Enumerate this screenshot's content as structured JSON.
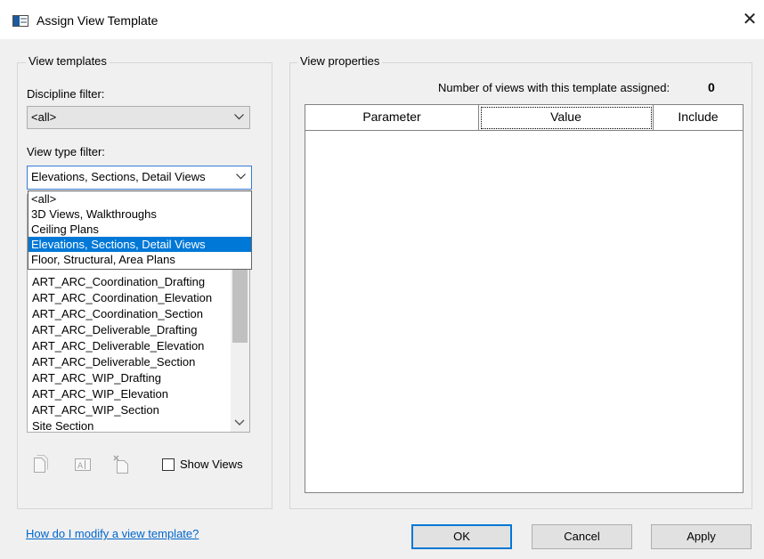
{
  "window": {
    "title": "Assign View Template",
    "close_glyph": "✕"
  },
  "view_templates": {
    "group_title": "View templates",
    "discipline_filter_label": "Discipline filter:",
    "discipline_filter_value": "<all>",
    "view_type_filter_label": "View type filter:",
    "view_type_filter_value": "Elevations, Sections, Detail Views",
    "dropdown_options": [
      "<all>",
      "3D Views, Walkthroughs",
      "Ceiling Plans",
      "Elevations, Sections, Detail Views",
      "Floor, Structural, Area Plans"
    ],
    "dropdown_selected_index": 3,
    "templates": [
      "ART_ARC_Coordination_Drafting",
      "ART_ARC_Coordination_Elevation",
      "ART_ARC_Coordination_Section",
      "ART_ARC_Deliverable_Drafting",
      "ART_ARC_Deliverable_Elevation",
      "ART_ARC_Deliverable_Section",
      "ART_ARC_WIP_Drafting",
      "ART_ARC_WIP_Elevation",
      "ART_ARC_WIP_Section",
      "Site Section"
    ],
    "show_views_label": "Show Views",
    "show_views_checked": false,
    "tool_icons": [
      "duplicate-icon",
      "rename-icon",
      "delete-icon"
    ]
  },
  "view_properties": {
    "group_title": "View properties",
    "count_label": "Number of views with this template assigned:",
    "count_value": "0",
    "columns": [
      "Parameter",
      "Value",
      "Include"
    ]
  },
  "footer": {
    "help_link": "How do I modify a view template?",
    "ok_label": "OK",
    "cancel_label": "Cancel",
    "apply_label": "Apply"
  },
  "colors": {
    "selection": "#0078d7",
    "link": "#0066cc",
    "dialog_bg": "#f0f0f0"
  }
}
